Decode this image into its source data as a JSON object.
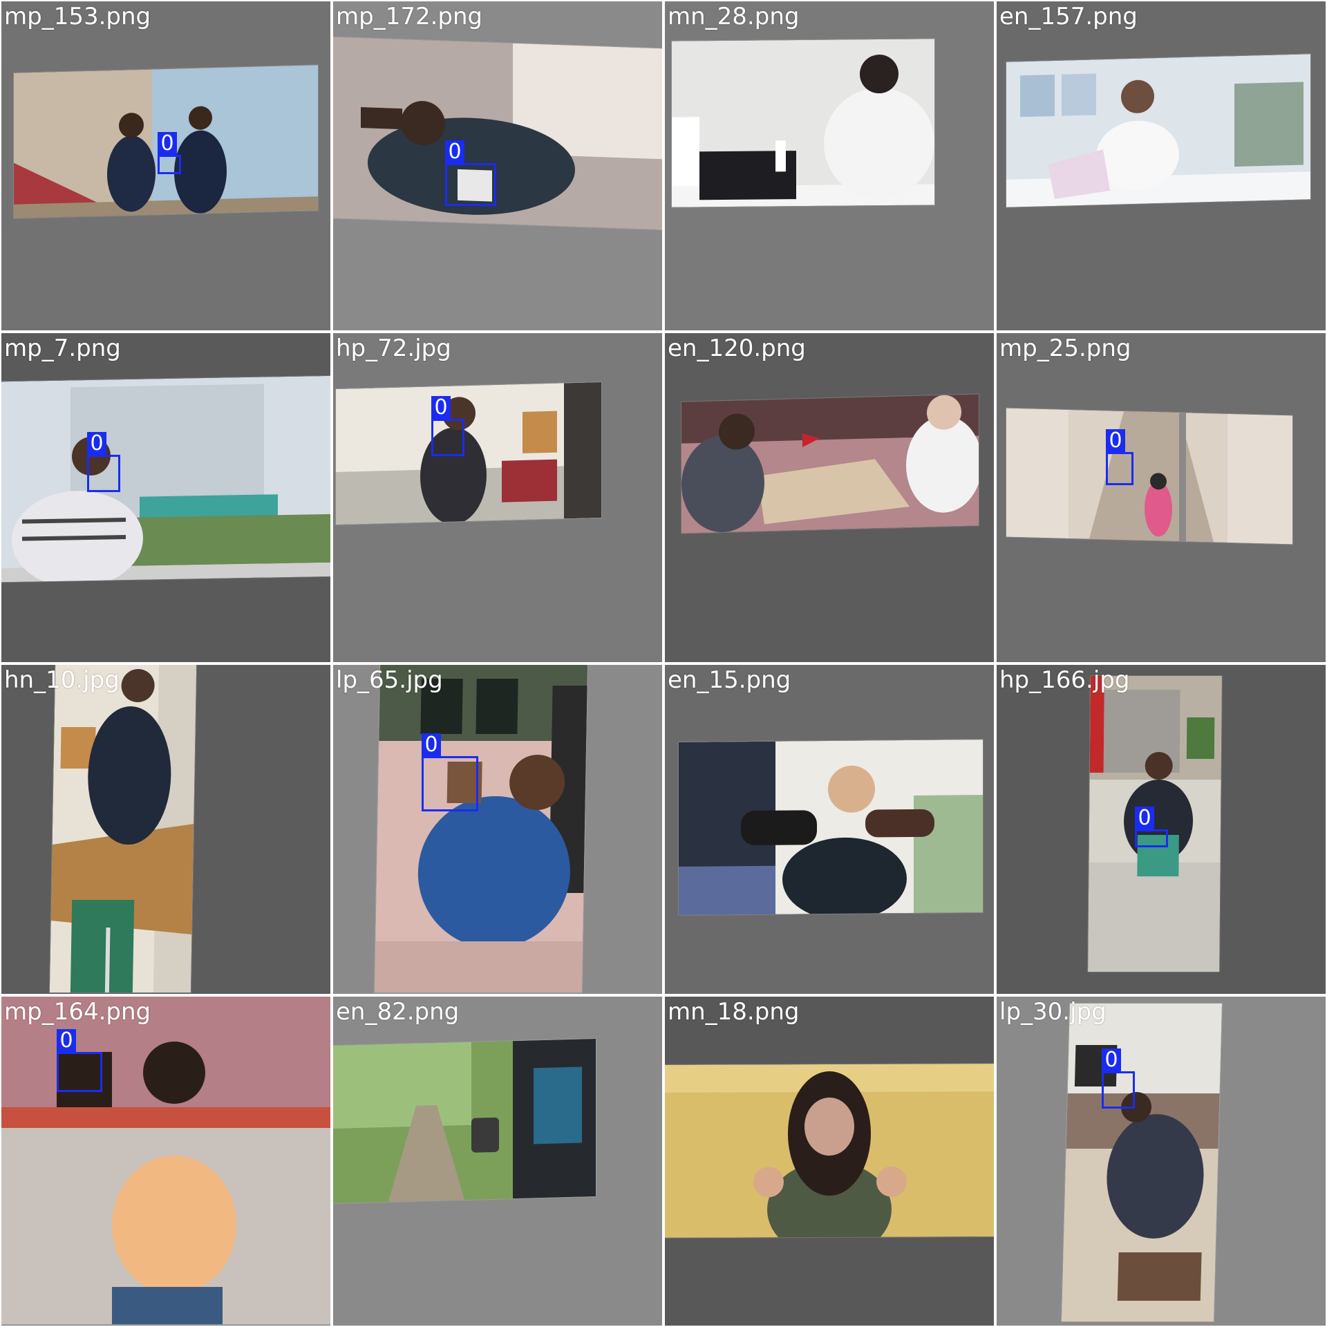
{
  "grid": {
    "columns": 4,
    "rows": 4,
    "box_color": "#1a2cf0",
    "tiles": [
      {
        "filename": "mp_153.png",
        "detections": [
          {
            "class_label": "0"
          }
        ]
      },
      {
        "filename": "mp_172.png",
        "detections": [
          {
            "class_label": "0"
          }
        ]
      },
      {
        "filename": "mn_28.png",
        "detections": []
      },
      {
        "filename": "en_157.png",
        "detections": []
      },
      {
        "filename": "mp_7.png",
        "detections": [
          {
            "class_label": "0"
          }
        ]
      },
      {
        "filename": "hp_72.jpg",
        "detections": [
          {
            "class_label": "0"
          }
        ]
      },
      {
        "filename": "en_120.png",
        "detections": []
      },
      {
        "filename": "mp_25.png",
        "detections": [
          {
            "class_label": "0"
          }
        ]
      },
      {
        "filename": "hn_10.jpg",
        "detections": []
      },
      {
        "filename": "lp_65.jpg",
        "detections": [
          {
            "class_label": "0"
          }
        ]
      },
      {
        "filename": "en_15.png",
        "detections": []
      },
      {
        "filename": "hp_166.jpg",
        "detections": [
          {
            "class_label": "0"
          }
        ]
      },
      {
        "filename": "mp_164.png",
        "detections": [
          {
            "class_label": "0"
          }
        ]
      },
      {
        "filename": "en_82.png",
        "detections": []
      },
      {
        "filename": "mn_18.png",
        "detections": []
      },
      {
        "filename": "lp_30.jpg",
        "detections": [
          {
            "class_label": "0"
          }
        ]
      }
    ]
  }
}
